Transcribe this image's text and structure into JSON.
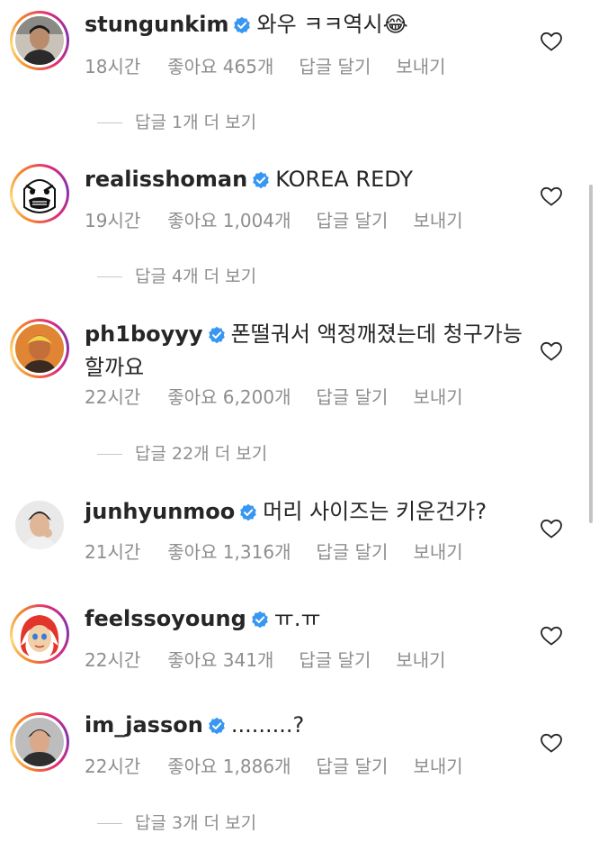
{
  "comments": [
    {
      "username": "stungunkim",
      "text": "와우 ㅋㅋ역시",
      "emoji": "😂",
      "time": "18시간",
      "likes": "좋아요 465개",
      "reply": "답글 달기",
      "send": "보내기",
      "more_replies": "답글 1개 더 보기",
      "story_ring": true
    },
    {
      "username": "realisshoman",
      "text": "KOREA REDY",
      "time": "19시간",
      "likes": "좋아요 1,004개",
      "reply": "답글 달기",
      "send": "보내기",
      "more_replies": "답글 4개 더 보기",
      "story_ring": true
    },
    {
      "username": "ph1boyyy",
      "text": "폰떨궈서 액정깨졌는데 청구가능 할까요",
      "time": "22시간",
      "likes": "좋아요 6,200개",
      "reply": "답글 달기",
      "send": "보내기",
      "more_replies": "답글 22개 더 보기",
      "story_ring": true
    },
    {
      "username": "junhyunmoo",
      "text": "머리 사이즈는 키운건가?",
      "time": "21시간",
      "likes": "좋아요 1,316개",
      "reply": "답글 달기",
      "send": "보내기",
      "story_ring": false
    },
    {
      "username": "feelssoyoung",
      "text": "ㅠ.ㅠ",
      "time": "22시간",
      "likes": "좋아요 341개",
      "reply": "답글 달기",
      "send": "보내기",
      "story_ring": true
    },
    {
      "username": "im_jasson",
      "text": ".........?",
      "time": "22시간",
      "likes": "좋아요 1,886개",
      "reply": "답글 달기",
      "send": "보내기",
      "more_replies": "답글 3개 더 보기",
      "story_ring": true
    }
  ],
  "icons": {
    "verified": "verified-badge-icon",
    "like": "heart-outline-icon"
  },
  "colors": {
    "verified": "#3897f0",
    "meta_text": "#8e8e8e",
    "text": "#262626"
  }
}
